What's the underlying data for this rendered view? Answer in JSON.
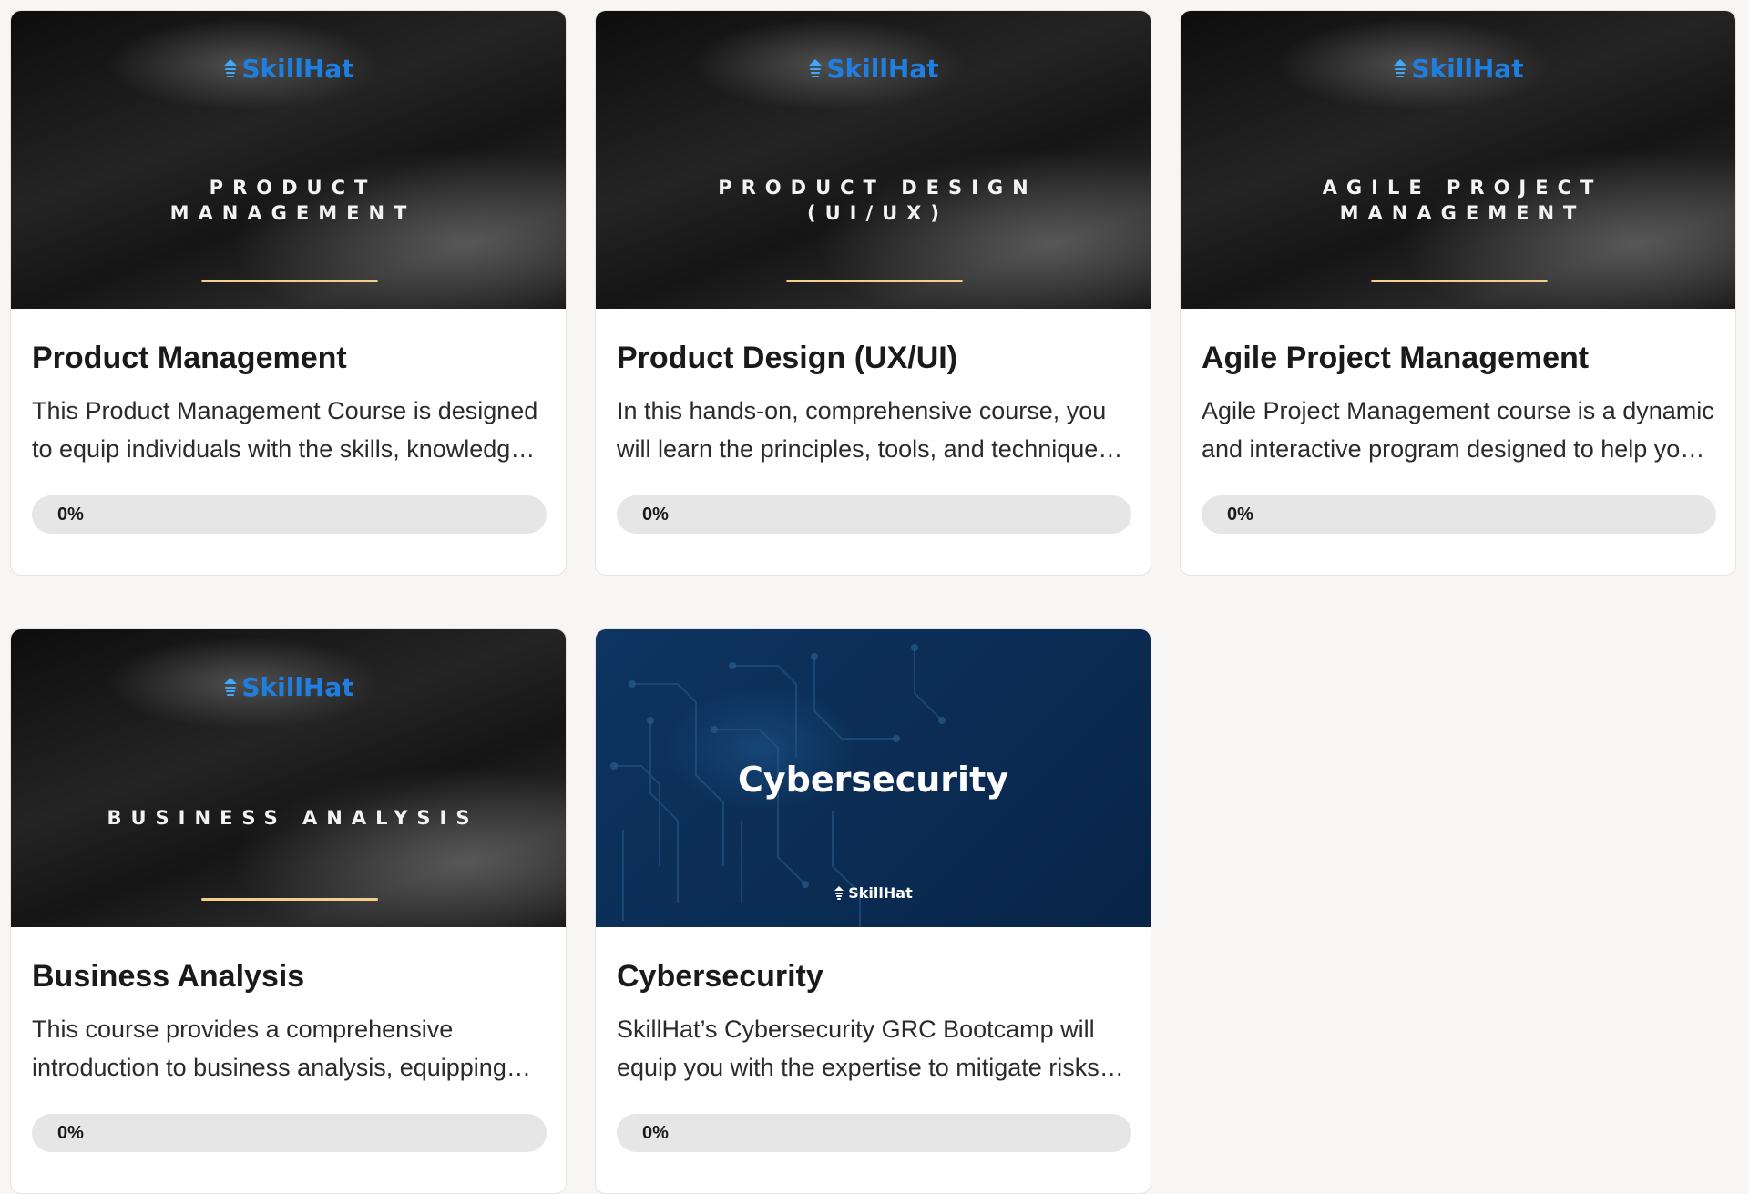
{
  "brand_name": "SkillHat",
  "courses": [
    {
      "thumb_style": "dark",
      "thumb_title": "PRODUCT\nMANAGEMENT",
      "title": "Product Management",
      "description": "This Product Management Course is designed to equip individuals with the skills, knowledge and frameworks needed to succeed in product management.",
      "progress_percent": 0,
      "progress_label": "0%"
    },
    {
      "thumb_style": "dark",
      "thumb_title": "PRODUCT DESIGN\n(UI/UX)",
      "title": "Product Design (UX/UI)",
      "description": "In this hands-on, comprehensive course, you will learn the principles, tools, and techniques of product design.",
      "progress_percent": 0,
      "progress_label": "0%"
    },
    {
      "thumb_style": "dark",
      "thumb_title": "AGILE PROJECT\nMANAGEMENT",
      "title": "Agile Project Management",
      "description": "Agile Project Management course is a dynamic and interactive program designed to help you master agile practices.",
      "progress_percent": 0,
      "progress_label": "0%"
    },
    {
      "thumb_style": "dark",
      "thumb_title": "BUSINESS ANALYSIS",
      "title": "Business Analysis",
      "description": "This course provides a comprehensive introduction to business analysis, equipping you with essential skills.",
      "progress_percent": 0,
      "progress_label": "0%"
    },
    {
      "thumb_style": "blue",
      "thumb_title": "Cybersecurity",
      "title": "Cybersecurity",
      "description": "SkillHat’s Cybersecurity GRC Bootcamp will equip you with the expertise to mitigate risks across organizations.",
      "progress_percent": 0,
      "progress_label": "0%"
    }
  ],
  "colors": {
    "brand_blue": "#1f7fe0",
    "gold_accent": "#f1cf8c",
    "cyber_bg": "#0b2d55",
    "progress_track": "#e6e6e6"
  }
}
